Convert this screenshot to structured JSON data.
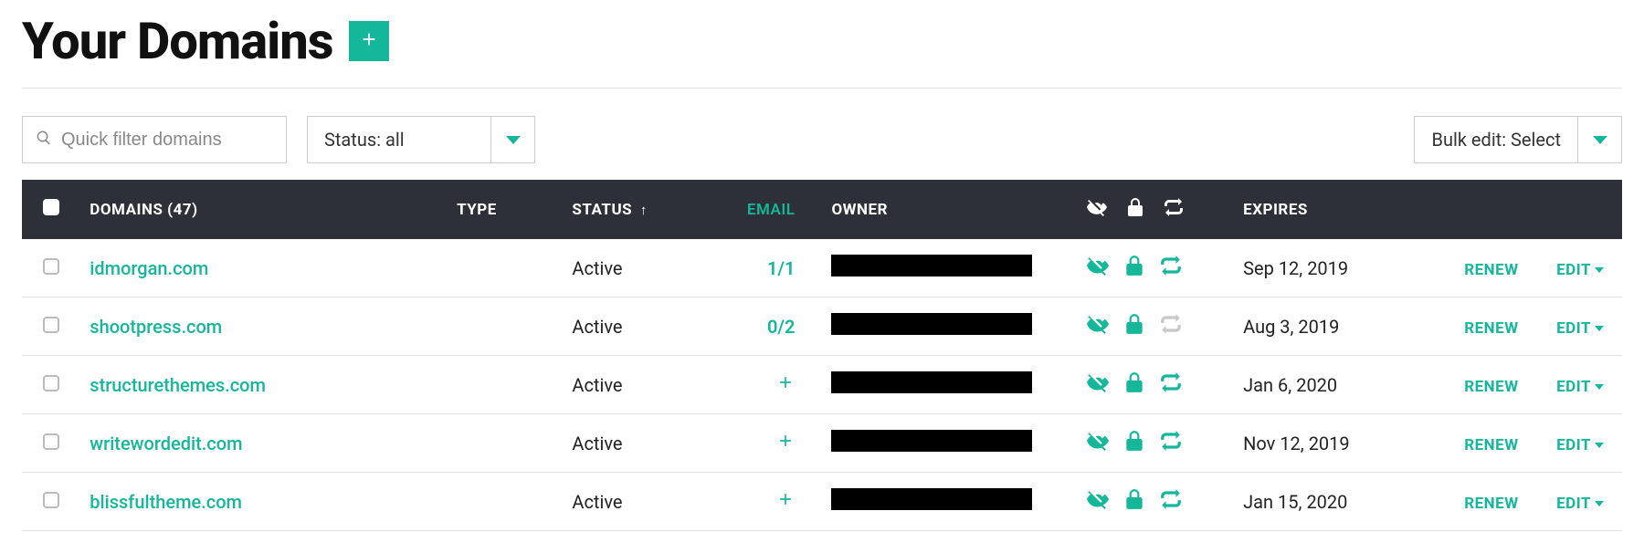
{
  "page_title": "Your Domains",
  "add_button_name": "add-domain",
  "search": {
    "placeholder": "Quick filter domains"
  },
  "status_filter": {
    "label": "Status: all"
  },
  "bulk_edit": {
    "label": "Bulk edit: Select"
  },
  "table": {
    "count": 47,
    "headers": {
      "domains": "DOMAINS (47)",
      "type": "TYPE",
      "status": "STATUS",
      "status_sort": "↑",
      "email": "EMAIL",
      "owner": "OWNER",
      "expires": "EXPIRES"
    },
    "rows": [
      {
        "domain": "idmorgan.com",
        "type": "",
        "status": "Active",
        "email": "1/1",
        "email_is_plus": false,
        "privacy": true,
        "lock": true,
        "autorenew": true,
        "expires": "Sep 12, 2019",
        "renew": "RENEW",
        "edit": "EDIT"
      },
      {
        "domain": "shootpress.com",
        "type": "",
        "status": "Active",
        "email": "0/2",
        "email_is_plus": false,
        "privacy": true,
        "lock": true,
        "autorenew": false,
        "expires": "Aug 3, 2019",
        "renew": "RENEW",
        "edit": "EDIT"
      },
      {
        "domain": "structurethemes.com",
        "type": "",
        "status": "Active",
        "email": "+",
        "email_is_plus": true,
        "privacy": true,
        "lock": true,
        "autorenew": true,
        "expires": "Jan 6, 2020",
        "renew": "RENEW",
        "edit": "EDIT"
      },
      {
        "domain": "writewordedit.com",
        "type": "",
        "status": "Active",
        "email": "+",
        "email_is_plus": true,
        "privacy": true,
        "lock": true,
        "autorenew": true,
        "expires": "Nov 12, 2019",
        "renew": "RENEW",
        "edit": "EDIT"
      },
      {
        "domain": "blissfultheme.com",
        "type": "",
        "status": "Active",
        "email": "+",
        "email_is_plus": true,
        "privacy": true,
        "lock": true,
        "autorenew": true,
        "expires": "Jan 15, 2020",
        "renew": "RENEW",
        "edit": "EDIT"
      }
    ]
  }
}
